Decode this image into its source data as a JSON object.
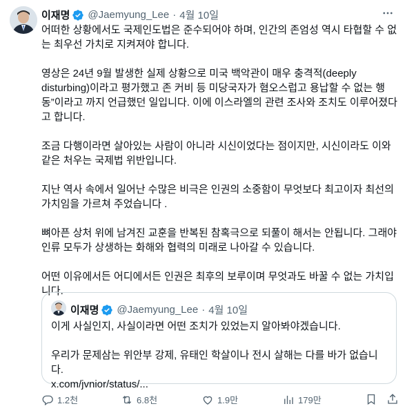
{
  "post": {
    "author_name": "이재명",
    "handle": "@Jaemyung_Lee",
    "separator": "·",
    "time": "4월 10일",
    "paragraphs": [
      "어떠한 상황에서도 국제인도법은 준수되어야 하며, 인간의 존엄성 역시 타협할 수 없는 최우선 가치로 지켜져야 합니다.",
      "영상은 24년 9월 발생한 실제 상황으로 미국 백악관이 매우 충격적(deeply disturbing)이라고 평가했고 존 커비 등 미당국자가 혐오스럽고 용납할 수 없는 행동”이라고 까지 언급했던 일입니다. 이에 이스라엘의 관련 조사와 조치도 이루어졌다고 합니다.",
      "조금 다행이라면 살아있는 사람이 아니라 시신이었다는 점이지만, 시신이라도 이와같은 처우는 국제법 위반입니다.",
      "지난 역사 속에서 일어난 수많은 비극은 인권의 소중함이 무엇보다 최고이자 최선의 가치임을 가르쳐 주었습니다 .",
      "뼈아픈 상처 위에 남겨진 교훈을 반복된 참혹극으로 되풀이 해서는 안됩니다. 그래야 인류 모두가 상생하는 화해와 협력의 미래로 나아갈 수 있습니다.",
      "어떤 이유에서든 어디에서든 인권은 최후의 보루이며 무엇과도 바꿀 수 없는 가치입니다."
    ]
  },
  "quote": {
    "author_name": "이재명",
    "handle": "@Jaemyung_Lee",
    "separator": "·",
    "time": "4월 10일",
    "line1": "이게 사실인지, 사실이라면 어떤 조치가 있었는지 알아봐야겠습니다.",
    "line2": "우리가 문제삼는 위안부 강제, 유태인 학살이나 전시 살해는 다를 바가 없습니다.",
    "link": "x.com/jvnior/status/..."
  },
  "actions": {
    "replies": "1.2천",
    "reposts": "6.8천",
    "likes": "1.9만",
    "views": "179만"
  },
  "colors": {
    "verified": "#1d9bf0",
    "muted": "#536471",
    "border": "#cfd9de",
    "text": "#0f1419"
  },
  "icons": [
    "verified-badge-icon",
    "more-icon",
    "reply-icon",
    "repost-icon",
    "like-icon",
    "views-icon",
    "bookmark-icon",
    "share-icon"
  ]
}
